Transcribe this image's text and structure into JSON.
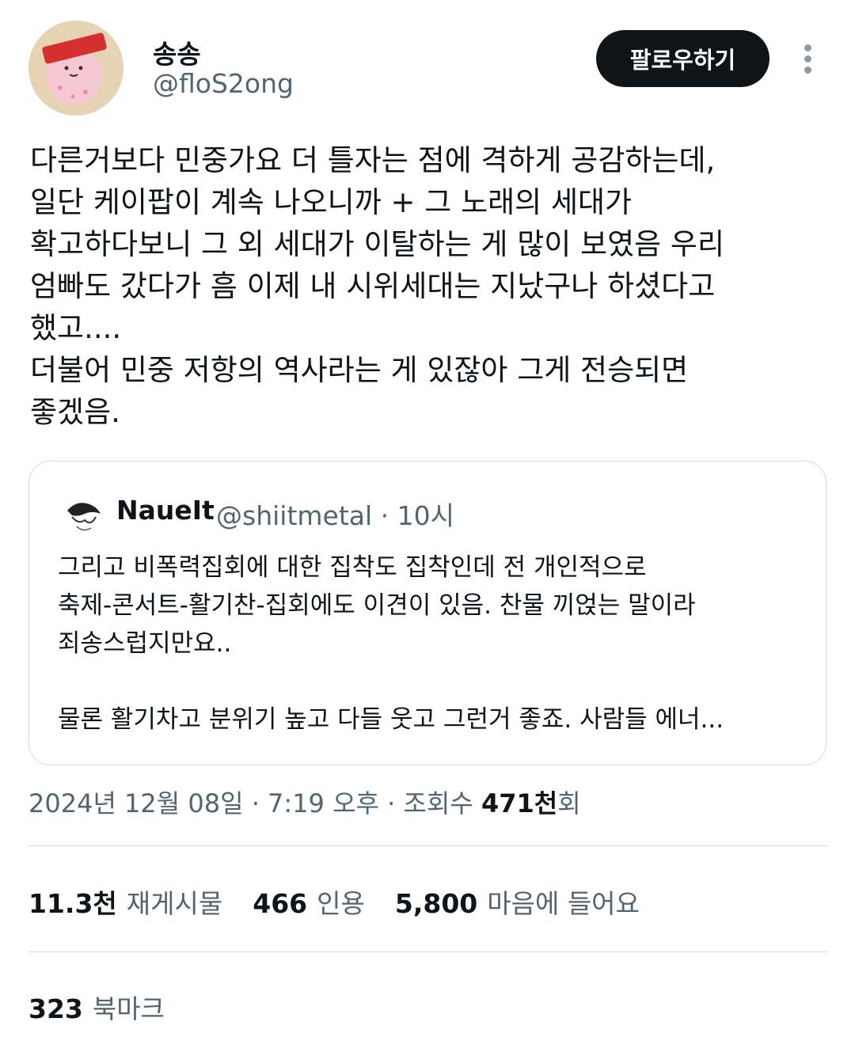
{
  "author": {
    "name": "송송",
    "handle": "@floS2ong",
    "follow_label": "팔로우하기",
    "avatar_icon": "pink-character-headband-avatar"
  },
  "tweet": {
    "text": "다른거보다 민중가요 더 틀자는 점에 격하게 공감하는데,\n일단 케이팝이 계속 나오니까 + 그 노래의 세대가\n확고하다보니 그 외 세대가 이탈하는 게 많이 보였음 우리\n엄빠도 갔다가 흠 이제 내 시위세대는 지났구나 하셨다고\n했고....\n더불어 민중 저항의 역사라는 게 있잖아 그게 전승되면\n좋겠음."
  },
  "quote": {
    "name": "NaueIt",
    "meta": "@shiitmetal · 10시",
    "text": "그리고 비폭력집회에 대한 집착도 집착인데 전 개인적으로\n축제-콘서트-활기찬-집회에도 이견이 있음. 찬물 끼얹는 말이라\n죄송스럽지만요..\n\n물론 활기차고 분위기 높고 다들 웃고 그런거 좋죠. 사람들 에너..."
  },
  "timestamp": {
    "prefix": "2024년 12월 08일 · 7:19 오후 · 조회수 ",
    "views": "471천",
    "suffix": "회"
  },
  "stats": {
    "retweets_count": "11.3천",
    "retweets_label": "재게시물",
    "quotes_count": "466",
    "quotes_label": "인용",
    "likes_count": "5,800",
    "likes_label": "마음에 들어요"
  },
  "bookmarks": {
    "count": "323",
    "label": "북마크"
  }
}
